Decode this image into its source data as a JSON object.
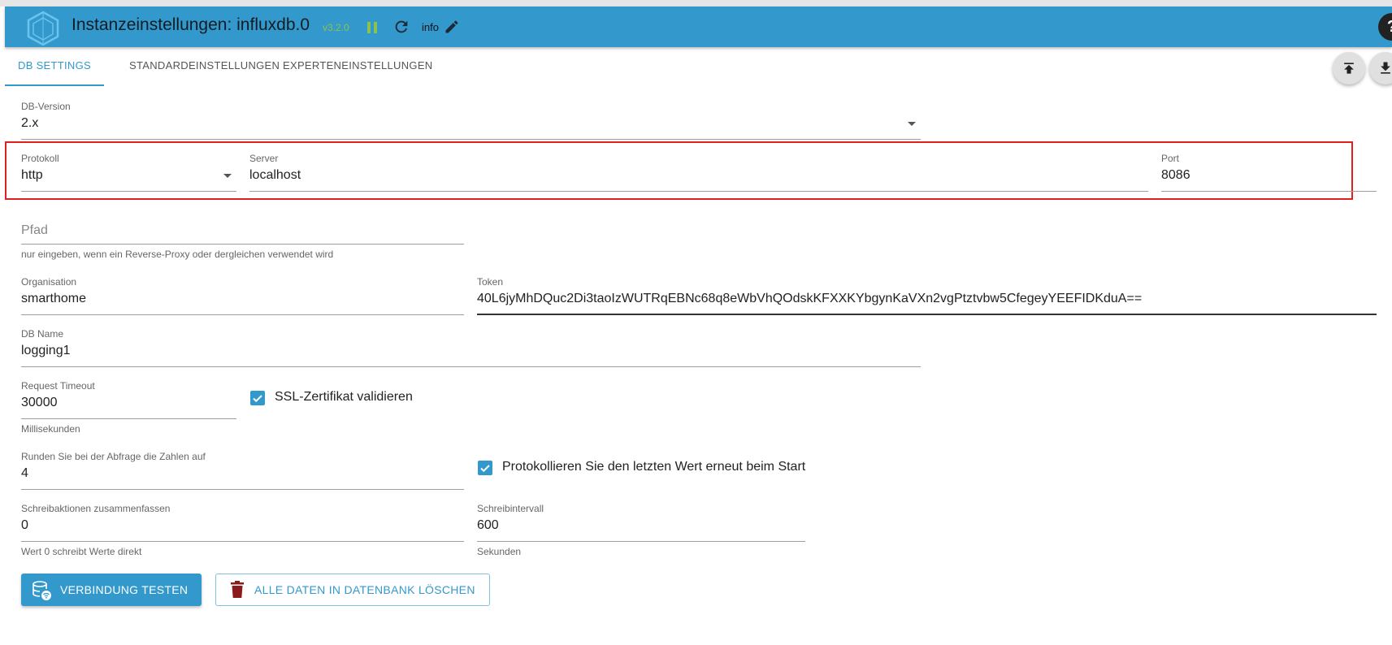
{
  "header": {
    "title": "Instanzeinstellungen: influxdb.0",
    "version": "v3.2.0",
    "info_label": "info",
    "help_label": "?",
    "icons": [
      "logo-icon",
      "pause-icon",
      "refresh-icon",
      "edit-icon",
      "help-icon"
    ],
    "colors": {
      "bar": "#3399cc",
      "version": "#8bc34a",
      "pause": "#8bc34a"
    }
  },
  "tabs": [
    {
      "label": "DB SETTINGS",
      "active": true
    },
    {
      "label": "STANDARDEINSTELLUNGEN",
      "active": false
    },
    {
      "label": "EXPERTENEINSTELLUNGEN",
      "active": false
    }
  ],
  "toolbar": {
    "icons": [
      "upload-icon",
      "download-icon"
    ]
  },
  "form": {
    "db_version": {
      "label": "DB-Version",
      "value": "2.x"
    },
    "protocol": {
      "label": "Protokoll",
      "value": "http"
    },
    "server": {
      "label": "Server",
      "value": "localhost"
    },
    "port": {
      "label": "Port",
      "value": "8086"
    },
    "path": {
      "placeholder": "Pfad",
      "value": "",
      "helper": "nur eingeben, wenn ein Reverse-Proxy oder dergleichen verwendet wird"
    },
    "organisation": {
      "label": "Organisation",
      "value": "smarthome"
    },
    "token": {
      "label": "Token",
      "value": "40L6jyMhDQuc2Di3taoIzWUTRqEBNc68q8eWbVhQOdskKFXXKYbgynKaVXn2vgPtztvbw5CfegeyYEEFIDKduA=="
    },
    "db_name": {
      "label": "DB Name",
      "value": "logging1"
    },
    "request_timeout": {
      "label": "Request Timeout",
      "value": "30000",
      "helper": "Millisekunden"
    },
    "ssl_validate": {
      "label": "SSL-Zertifikat validieren",
      "checked": true
    },
    "round": {
      "label": "Runden Sie bei der Abfrage die Zahlen auf",
      "value": "4"
    },
    "log_last_value": {
      "label": "Protokollieren Sie den letzten Wert erneut beim Start",
      "checked": true
    },
    "combine_writes": {
      "label": "Schreibaktionen zusammenfassen",
      "value": "0",
      "helper": "Wert 0 schreibt Werte direkt"
    },
    "write_interval": {
      "label": "Schreibintervall",
      "value": "600",
      "helper": "Sekunden"
    }
  },
  "buttons": {
    "test_connection": "VERBINDUNG TESTEN",
    "delete_all": "ALLE DATEN IN DATENBANK LÖSCHEN"
  },
  "colors": {
    "accent": "#3399cc",
    "highlight_border": "#e02020",
    "delete_icon": "#8b1a1a"
  }
}
